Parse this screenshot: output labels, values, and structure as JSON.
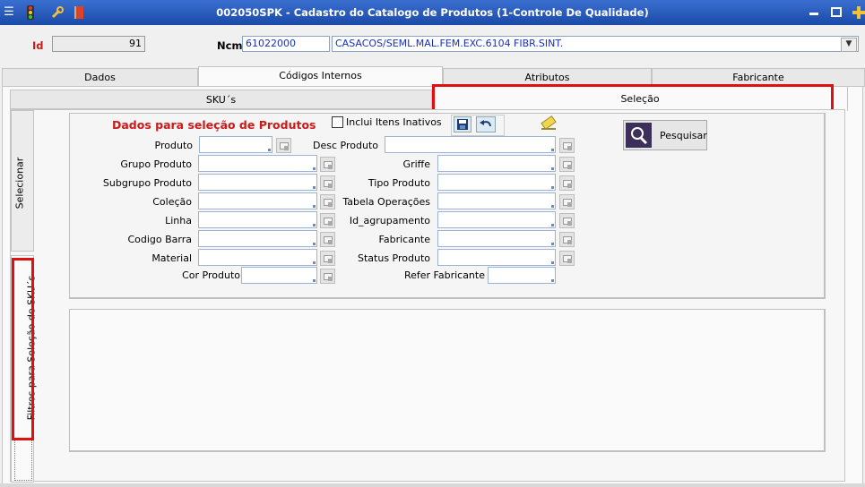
{
  "window": {
    "title": "002050SPK - Cadastro do Catalogo de Produtos (1-Controle De Qualidade)",
    "icons": [
      "menu-icon",
      "traffic-light-icon",
      "wrench-icon",
      "book-icon"
    ],
    "controls": [
      "minimize-icon",
      "restore-icon",
      "close-icon",
      "add-icon"
    ]
  },
  "header": {
    "id_label": "Id",
    "id_value": "91",
    "ncm_label": "Ncm",
    "ncm_code": "61022000",
    "ncm_description": "CASACOS/SEML.MAL.FEM.EXC.6104 FIBR.SINT."
  },
  "main_tabs": [
    {
      "label": "Dados",
      "active": false
    },
    {
      "label": "Códigos Internos",
      "active": true
    },
    {
      "label": "Atributos",
      "active": false
    },
    {
      "label": "Fabricante",
      "active": false
    }
  ],
  "sub_tabs": [
    {
      "label": "SKU´s",
      "active": false
    },
    {
      "label": "Seleção",
      "active": true
    }
  ],
  "side_tabs": [
    {
      "label": "Selecionar"
    },
    {
      "label": "Filtros para Seleção de SKU´s"
    }
  ],
  "form": {
    "title": "Dados para seleção de Produtos",
    "include_inactive_label": "Inclui Itens Inativos",
    "include_inactive_checked": false,
    "search_button": "Pesquisar",
    "fields_left": [
      "Produto",
      "Grupo Produto",
      "Subgrupo Produto",
      "Coleção",
      "Linha",
      "Codigo Barra",
      "Material",
      "Cor Produto"
    ],
    "fields_right": [
      "Desc Produto",
      "Griffe",
      "Tipo Produto",
      "Tabela Operações",
      "Id_agrupamento",
      "Fabricante",
      "Status Produto",
      "Refer Fabricante"
    ]
  }
}
